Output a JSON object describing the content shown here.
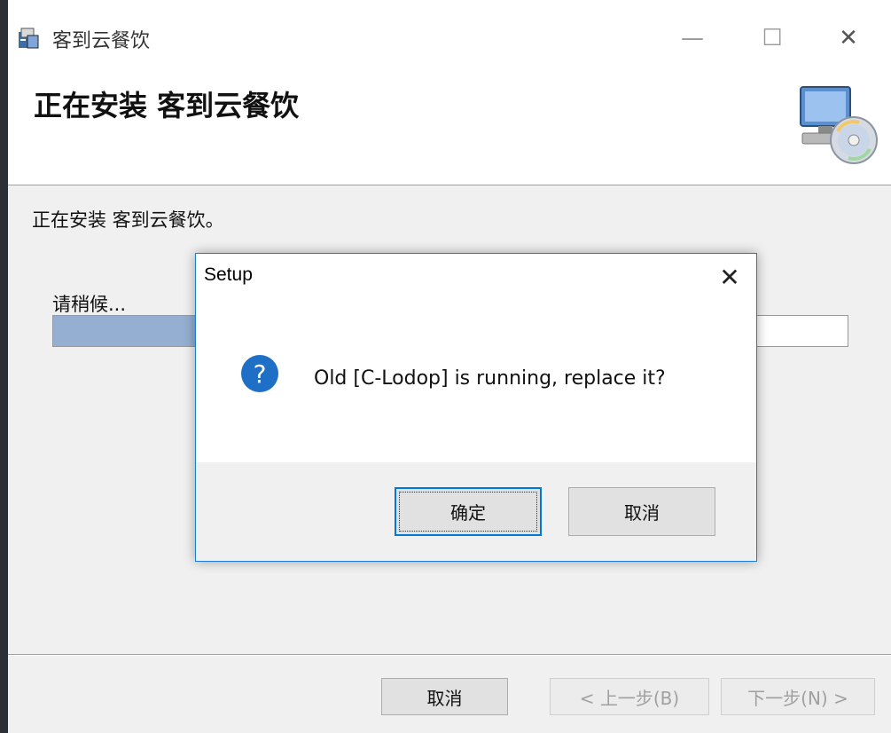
{
  "window": {
    "title": "客到云餐饮",
    "controls": {
      "minimize": "—",
      "maximize": "☐",
      "close": "✕"
    }
  },
  "header": {
    "title": "正在安装 客到云餐饮"
  },
  "body": {
    "status": "正在安装 客到云餐饮。",
    "wait": "请稍候...",
    "progress": 0.4
  },
  "footer": {
    "cancel": "取消",
    "back": "< 上一步(B)",
    "next": "下一步(N) >"
  },
  "dialog": {
    "title": "Setup",
    "close": "✕",
    "message": "Old [C-Lodop] is running, replace it?",
    "icon": "question-icon",
    "ok": "确定",
    "cancel": "取消"
  },
  "colors": {
    "accent": "#0078d7",
    "progress": "#94afd1",
    "question_icon": "#1e6fc5"
  }
}
